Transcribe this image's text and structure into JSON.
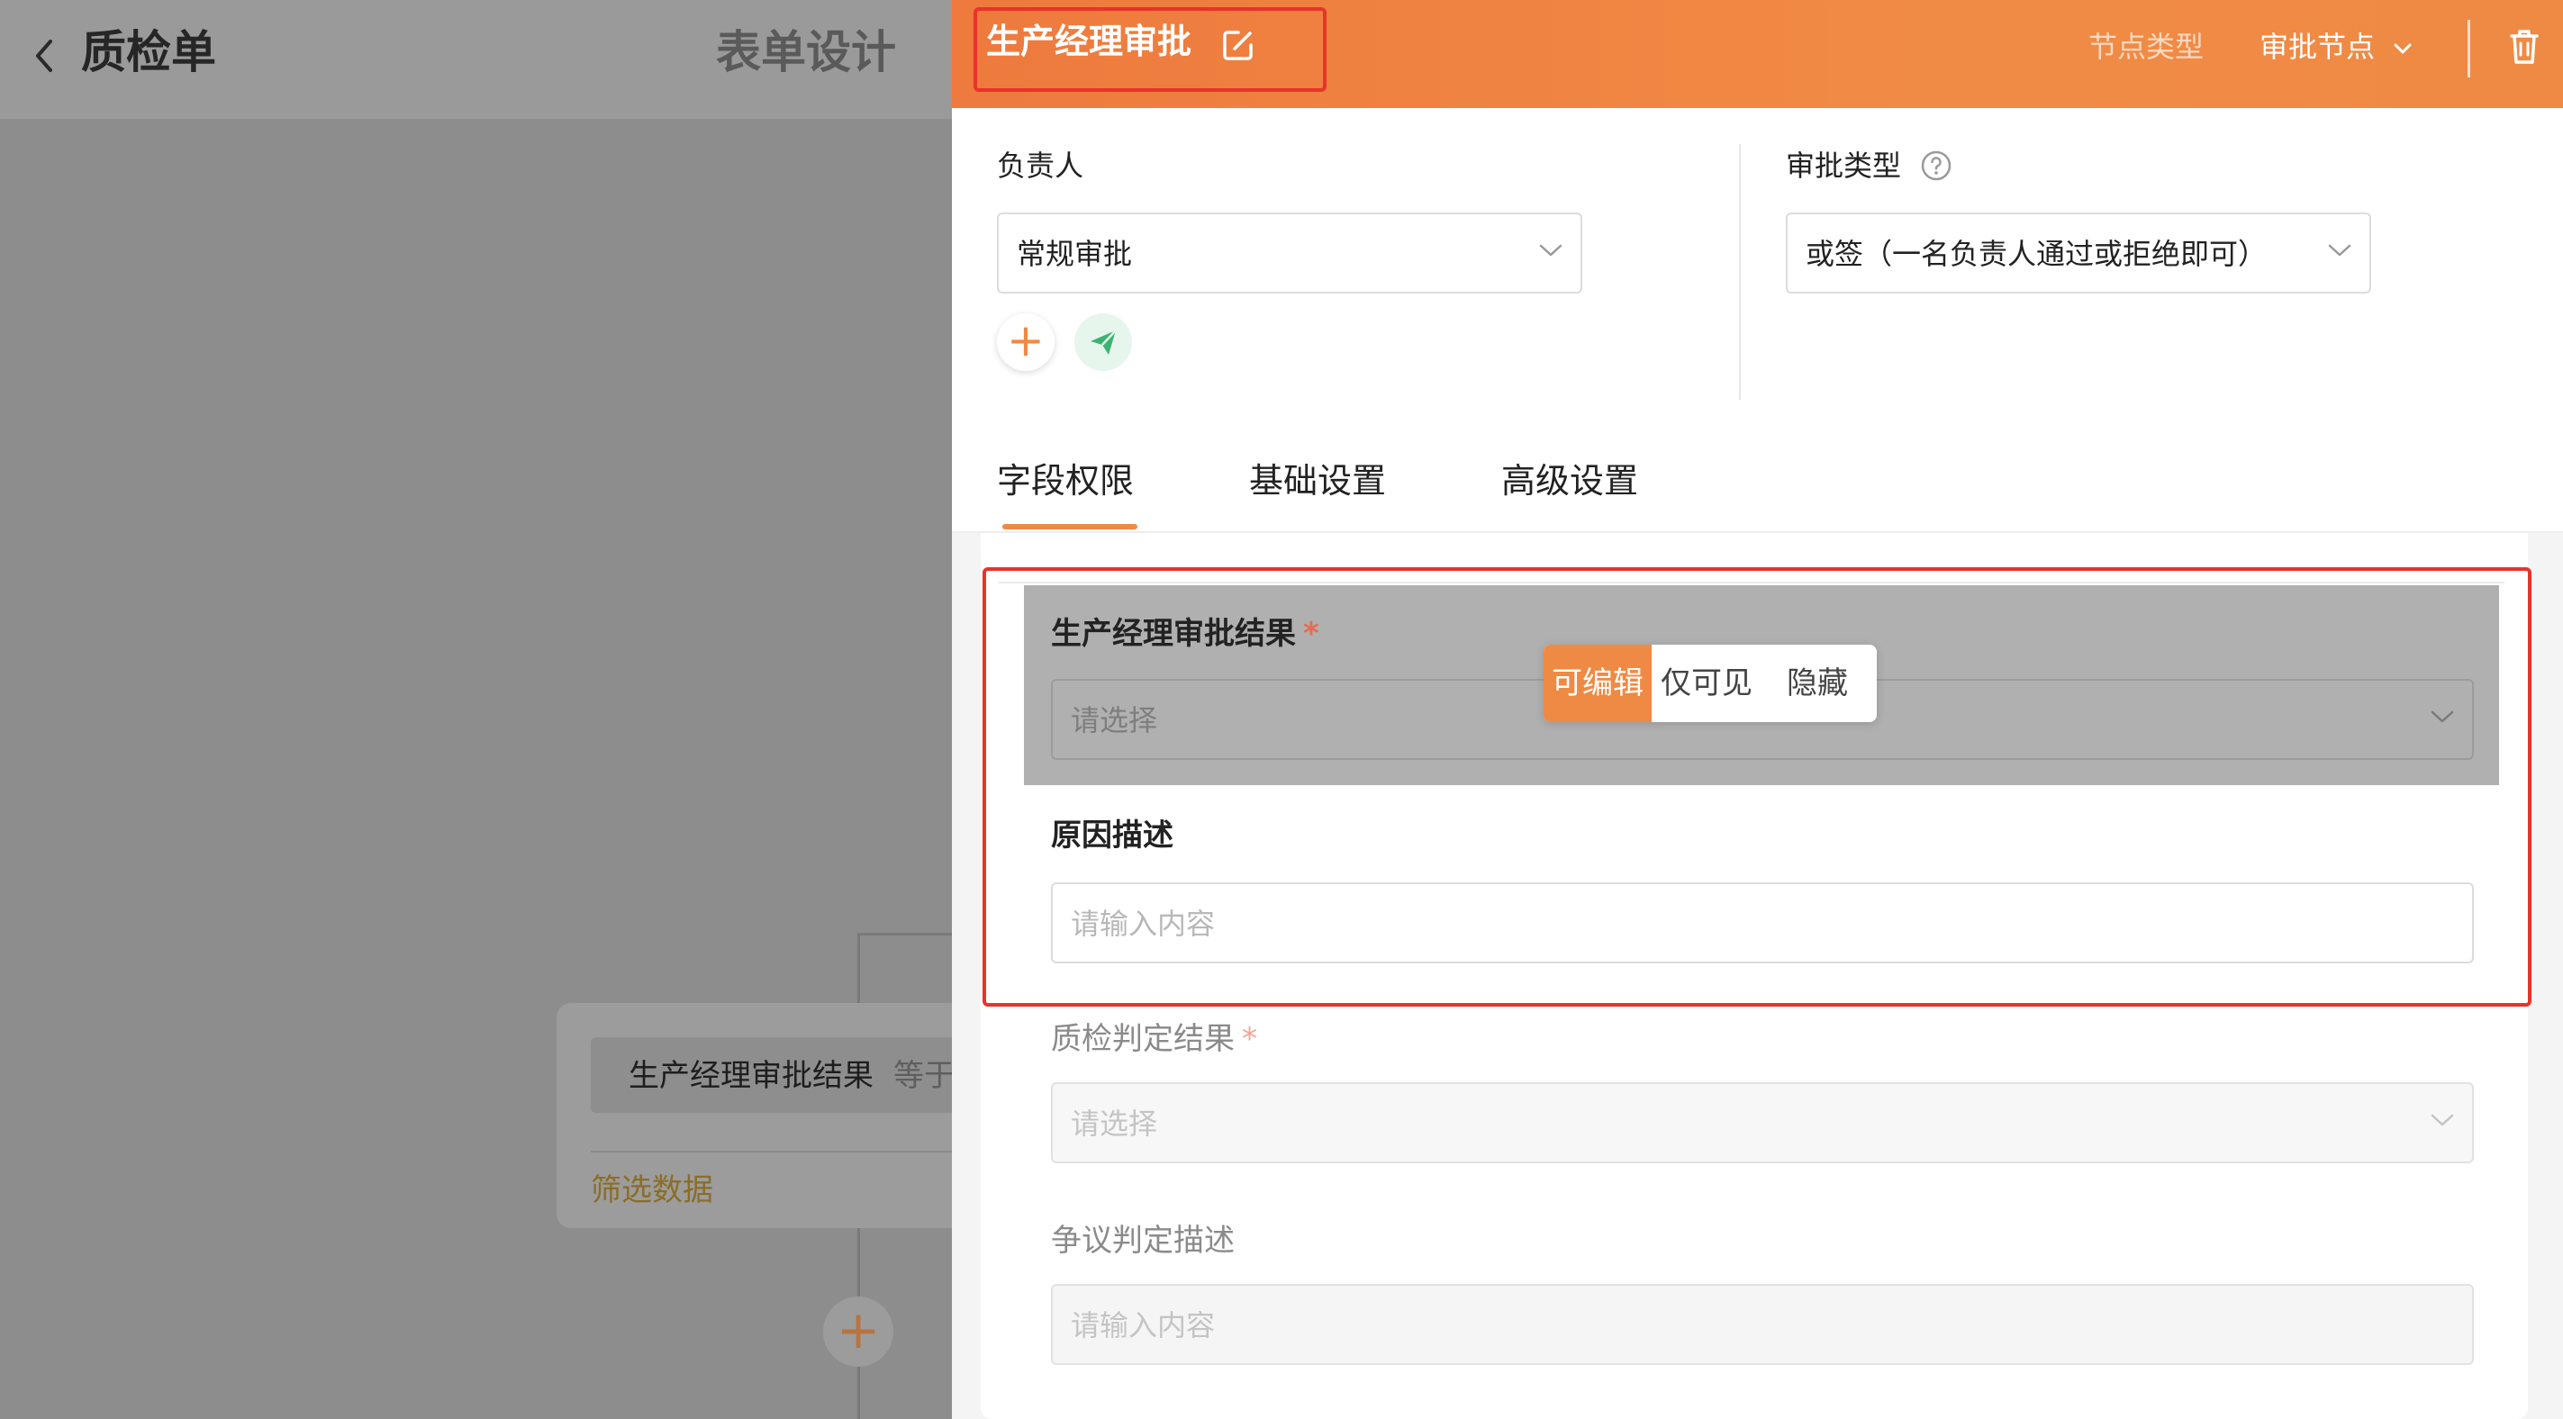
{
  "background": {
    "page_title": "质检单",
    "form_design_tab": "表单设计",
    "condition_card": {
      "field": "生产经理审批结果",
      "operator": "等于",
      "filter_link": "筛选数据"
    },
    "add_node_symbol": "+"
  },
  "drawer": {
    "node_title": "生产经理审批",
    "node_type_label": "节点类型",
    "node_type_value": "审批节点",
    "assignee": {
      "label": "负责人",
      "value": "常规审批"
    },
    "approval_type": {
      "label": "审批类型",
      "value": "或签（一名负责人通过或拒绝即可）"
    },
    "add_symbol": "+",
    "tabs": [
      {
        "label": "字段权限",
        "active": true
      },
      {
        "label": "基础设置",
        "active": false
      },
      {
        "label": "高级设置",
        "active": false
      }
    ],
    "permission_options": [
      "可编辑",
      "仅可见",
      "隐藏"
    ],
    "permission_selected": "可编辑",
    "fields": [
      {
        "label": "生产经理审批结果",
        "required": true,
        "placeholder": "请选择",
        "type": "select"
      },
      {
        "label": "原因描述",
        "required": false,
        "placeholder": "请输入内容",
        "type": "text"
      },
      {
        "label": "质检判定结果",
        "required": true,
        "placeholder": "请选择",
        "type": "select"
      },
      {
        "label": "争议判定描述",
        "required": false,
        "placeholder": "请输入内容",
        "type": "text"
      }
    ],
    "required_mark": "*"
  },
  "colors": {
    "accent": "#ef8a44",
    "highlight_border": "#e8332a",
    "cc_green": "#3cb371"
  },
  "icons": {
    "back": "chevron-left-icon",
    "edit": "edit-icon",
    "dropdown": "chevron-down-icon",
    "delete": "trash-icon",
    "help": "question-circle-icon",
    "cc": "send-icon"
  }
}
